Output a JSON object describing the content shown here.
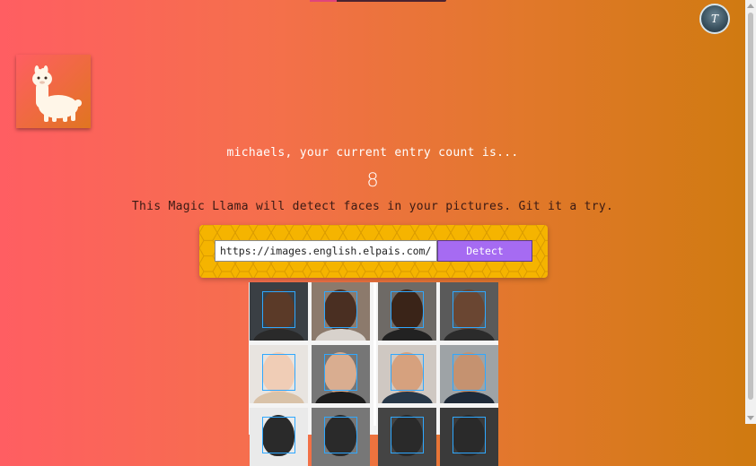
{
  "header": {
    "avatar_letter": "T"
  },
  "main": {
    "entry_text": "michaels, your current entry count is...",
    "entry_count": "8",
    "tagline": "This Magic Llama will detect faces in your pictures. Git it a try."
  },
  "form": {
    "url_value": "https://images.english.elpais.com/resizer/",
    "button_label": "Detect"
  },
  "colors": {
    "panel": "#f5b400",
    "button": "#a66bf2",
    "bbox": "#2fa8ff"
  },
  "results": {
    "faces_detected": 12
  }
}
